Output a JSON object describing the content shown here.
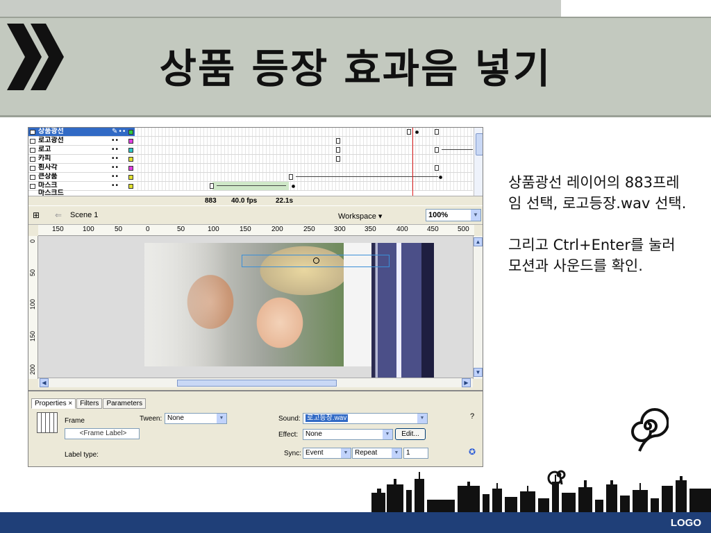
{
  "slide": {
    "title": "상품 등장 효과음 넣기",
    "desc_1": "상품광선 레이어의 883프레임 선택, 로고등장.wav 선택.",
    "desc_2": "그리고 Ctrl+Enter를 눌러 모션과 사운드를 확인.",
    "logo": "LOGO"
  },
  "timeline": {
    "layers": [
      "상품광선",
      "로고광선",
      "로고",
      "카피",
      "흰사각",
      "큰상품",
      "마스크",
      "마스크드"
    ],
    "selected_layer": "상품광선",
    "frame": "883",
    "fps": "40.0 fps",
    "time": "22.1s"
  },
  "stage": {
    "scene": "Scene 1",
    "workspace": "Workspace ▾",
    "zoom": "100%",
    "ruler_h": [
      "150",
      "100",
      "50",
      "0",
      "50",
      "100",
      "150",
      "200",
      "250",
      "300",
      "350",
      "400",
      "450",
      "500"
    ],
    "ruler_v": [
      "0",
      "50",
      "100",
      "150",
      "200"
    ]
  },
  "properties": {
    "tabs": [
      "Properties ×",
      "Filters",
      "Parameters"
    ],
    "type": "Frame",
    "frame_label_placeholder": "<Frame Label>",
    "tween_label": "Tween:",
    "tween_value": "None",
    "sound_label": "Sound:",
    "sound_value": "로고등장.wav",
    "effect_label": "Effect:",
    "effect_value": "None",
    "edit_button": "Edit...",
    "label_type_label": "Label type:",
    "sync_label": "Sync:",
    "sync_value": "Event",
    "repeat_value": "Repeat",
    "repeat_count": "1"
  }
}
